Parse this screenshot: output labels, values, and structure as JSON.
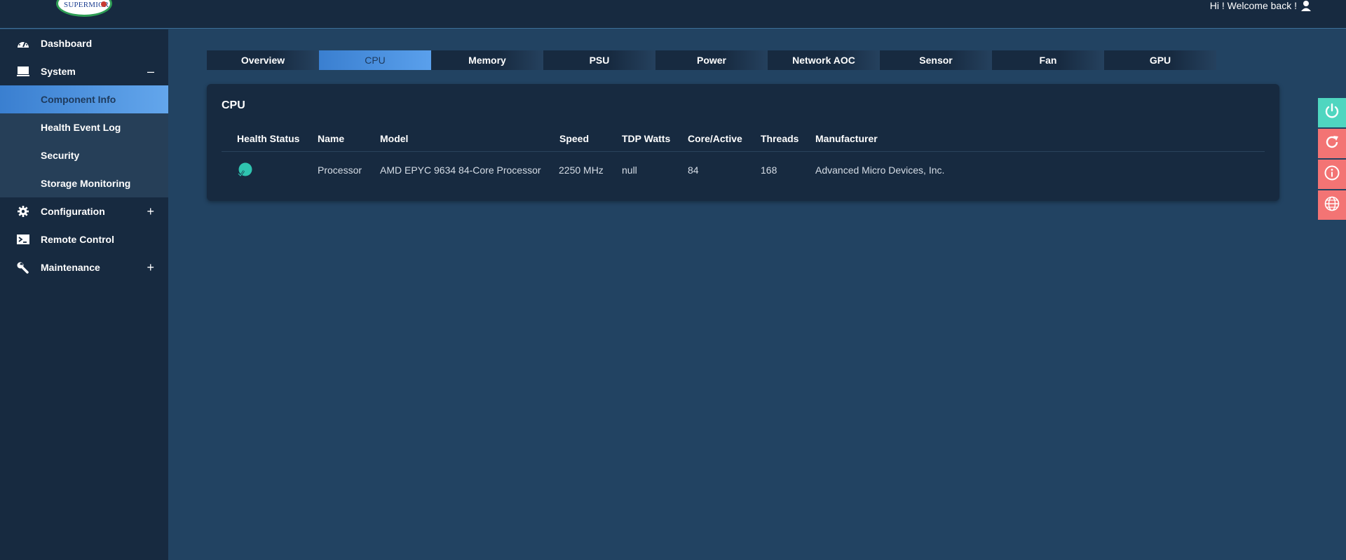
{
  "header": {
    "brand": "SUPERMICR",
    "welcome": "Hi ! Welcome back !",
    "user_icon": "user-icon"
  },
  "sidebar": {
    "items": [
      {
        "label": "Dashboard",
        "icon": "gauge-icon"
      },
      {
        "label": "System",
        "icon": "monitor-icon",
        "toggle": "–",
        "expanded": true
      },
      {
        "label": "Configuration",
        "icon": "gear-icon",
        "toggle": "+"
      },
      {
        "label": "Remote Control",
        "icon": "terminal-icon"
      },
      {
        "label": "Maintenance",
        "icon": "wrench-icon",
        "toggle": "+"
      }
    ],
    "system_subitems": [
      {
        "label": "Component Info",
        "active": true
      },
      {
        "label": "Health Event Log"
      },
      {
        "label": "Security"
      },
      {
        "label": "Storage Monitoring"
      }
    ]
  },
  "tabs": [
    {
      "label": "Overview"
    },
    {
      "label": "CPU",
      "active": true
    },
    {
      "label": "Memory"
    },
    {
      "label": "PSU"
    },
    {
      "label": "Power"
    },
    {
      "label": "Network AOC"
    },
    {
      "label": "Sensor"
    },
    {
      "label": "Fan"
    },
    {
      "label": "GPU"
    }
  ],
  "cpu_card": {
    "title": "CPU",
    "columns": [
      "Health Status",
      "Name",
      "Model",
      "Speed",
      "TDP Watts",
      "Core/Active",
      "Threads",
      "Manufacturer"
    ],
    "rows": [
      {
        "health_icon": "health-ok-icon",
        "name": "Processor",
        "model": "AMD EPYC 9634 84-Core Processor",
        "speed": "2250 MHz",
        "tdp_watts": "null",
        "core_active": "84",
        "threads": "168",
        "manufacturer": "Advanced Micro Devices, Inc."
      }
    ]
  },
  "side_actions": [
    {
      "icon": "power-icon",
      "color": "#4fd6c0"
    },
    {
      "icon": "refresh-icon",
      "color": "#f37474"
    },
    {
      "icon": "info-icon",
      "color": "#f37474"
    },
    {
      "icon": "globe-icon",
      "color": "#f37474"
    }
  ],
  "colors": {
    "background": "#224362",
    "panel": "#172a40",
    "accent": "#3a7fd0",
    "health_ok": "#2fc4b0"
  }
}
